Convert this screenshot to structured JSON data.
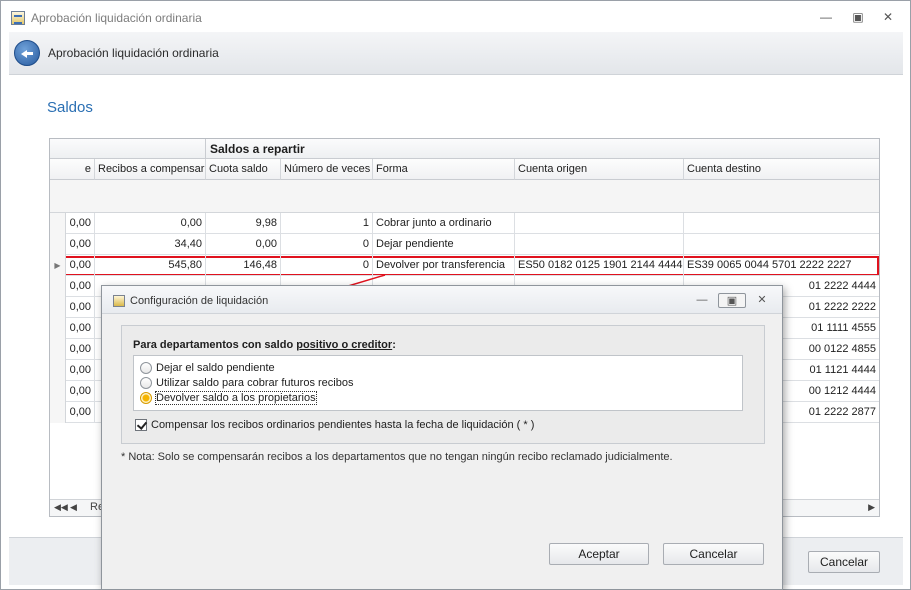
{
  "window": {
    "title": "Aprobación liquidación ordinaria"
  },
  "header": {
    "title": "Aprobación liquidación ordinaria"
  },
  "section": {
    "title": "Saldos"
  },
  "grid": {
    "band_title": "Saldos a repartir",
    "columns": [
      "e",
      "Recibos a compensar",
      "Cuota saldo",
      "Número de veces",
      "Forma",
      "Cuenta origen",
      "Cuenta destino"
    ],
    "rows": [
      [
        "0,00",
        "0,00",
        "9,98",
        "1",
        "Cobrar junto a ordinario",
        "",
        ""
      ],
      [
        "0,00",
        "34,40",
        "0,00",
        "0",
        "Dejar pendiente",
        "",
        ""
      ],
      [
        "0,00",
        "545,80",
        "146,48",
        "0",
        "Devolver por transferencia",
        "ES50 0182 0125 1901 2144 4444",
        "ES39 0065 0044 5701 2222 2227"
      ],
      [
        "0,00",
        "",
        "",
        "",
        "",
        "",
        "01 2222 4444"
      ],
      [
        "0,00",
        "",
        "",
        "",
        "",
        "",
        "01 2222 2222"
      ],
      [
        "0,00",
        "",
        "",
        "",
        "",
        "",
        "01 1111 4555"
      ],
      [
        "0,00",
        "",
        "",
        "",
        "",
        "",
        "00 0122 4855"
      ],
      [
        "0,00",
        "",
        "",
        "",
        "",
        "",
        "01 1121 4444"
      ],
      [
        "0,00",
        "",
        "",
        "",
        "",
        "",
        "00 1212 4444"
      ],
      [
        "0,00",
        "",
        "",
        "",
        "",
        "",
        "01 2222 2877"
      ]
    ],
    "selected_row": 2,
    "nav_label": "Re"
  },
  "footer": {
    "cancel_label": "Cancelar"
  },
  "dialog": {
    "title": "Configuración de liquidación",
    "group_title_prefix": "Para departamentos con saldo ",
    "group_title_emphasis": "positivo o creditor",
    "group_title_suffix": ":",
    "options": [
      {
        "label": "Dejar el saldo pendiente",
        "checked": false
      },
      {
        "label": "Utilizar saldo para cobrar futuros recibos",
        "checked": false
      },
      {
        "label": "Devolver saldo a los propietarios",
        "checked": true
      }
    ],
    "checkbox_label": "Compensar los recibos ordinarios pendientes hasta la fecha de liquidación ( * )",
    "checkbox_checked": true,
    "note": "* Nota: Solo se compensarán recibos a los departamentos que no tengan ningún recibo reclamado judicialmente.",
    "accept_label": "Aceptar",
    "cancel_label": "Cancelar"
  },
  "colors": {
    "accent": "#2a6fb3",
    "highlight": "#e0121e"
  }
}
